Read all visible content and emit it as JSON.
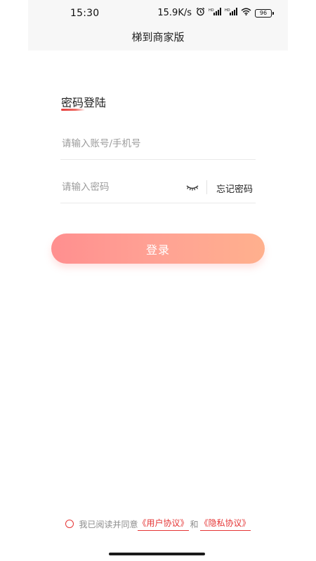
{
  "status_bar": {
    "time": "15:30",
    "net_speed": "15.9K/s",
    "battery": "96",
    "icons": [
      "alarm-icon",
      "signal-hd-icon",
      "signal-hd-icon",
      "wifi-icon",
      "battery-icon"
    ]
  },
  "header": {
    "title": "梯到商家版"
  },
  "login": {
    "title": "密码登陆",
    "account_placeholder": "请输入账号/手机号",
    "account_value": "",
    "password_placeholder": "请输入密码",
    "password_value": "",
    "forgot_label": "忘记密码",
    "submit_label": "登录"
  },
  "agreement": {
    "prefix": "我已阅读并同意",
    "user_agreement": "《用户协议》",
    "and": "和",
    "privacy_agreement": "《隐私协议》",
    "checked": false
  },
  "colors": {
    "accent": "#e53535",
    "button_gradient_start": "#ff8f8f",
    "button_gradient_end": "#ffb08d",
    "header_bg": "#f7f7f7"
  }
}
